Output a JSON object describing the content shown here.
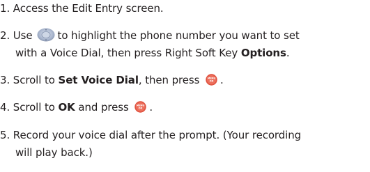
{
  "steps": [
    {
      "number": "1.",
      "text": "Access the Edit Entry screen."
    },
    {
      "number": "2.",
      "text_a": "Use",
      "icon_a": "navigation-key-icon",
      "text_b": "to highlight the phone number you want to set",
      "text_c": "with a Voice Dial,  then press Right Soft Key",
      "bold_a": "Options",
      "text_d": "."
    },
    {
      "number": "3.",
      "text_a": "Scroll to",
      "bold_a": "Set Voice Dial",
      "text_b": ", then press",
      "icon_a": "menu-ok-key-icon",
      "icon_label": "MENU OK",
      "text_c": "."
    },
    {
      "number": "4.",
      "text_a": "Scroll to",
      "bold_a": "OK",
      "text_b": "and press",
      "icon_a": "menu-ok-key-icon",
      "icon_label": "MENU OK",
      "text_c": "."
    },
    {
      "number": "5.",
      "text_a": "Record your voice dial after the prompt. (Your recording",
      "text_b": "will play back.)"
    }
  ],
  "colors": {
    "text": "#231f20",
    "menu_key": "#e0523f",
    "nav_key": "#9aa9c4"
  }
}
